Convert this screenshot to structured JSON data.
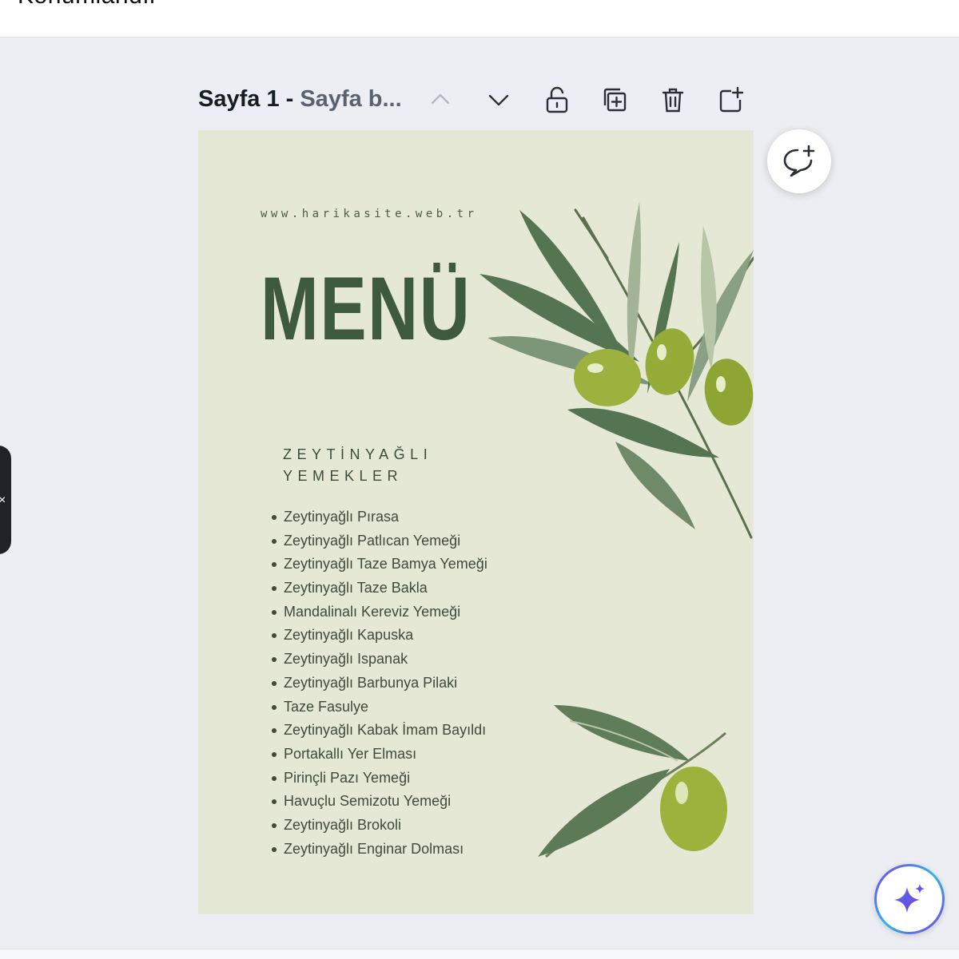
{
  "topbar": {
    "title": "Konumlandır"
  },
  "page_toolbar": {
    "page_number_label": "Sayfa 1 - ",
    "page_subtitle": "Sayfa b...",
    "buttons": {
      "move_up": "chevron-up-icon",
      "move_down": "chevron-down-icon",
      "lock": "unlock-icon",
      "duplicate": "duplicate-icon",
      "delete": "trash-icon",
      "add_page": "add-page-icon"
    }
  },
  "design": {
    "site_url": "www.harikasite.web.tr",
    "title": "MENÜ",
    "section_title": "ZEYTİNYAĞLI YEMEKLER",
    "dishes": [
      "Zeytinyağlı Pırasa",
      "Zeytinyağlı Patlıcan Yemeği",
      "Zeytinyağlı Taze Bamya Yemeği",
      "Zeytinyağlı Taze Bakla",
      "Mandalinalı Kereviz Yemeği",
      "Zeytinyağlı Kapuska",
      "Zeytinyağlı Ispanak",
      "Zeytinyağlı Barbunya Pilaki",
      "Taze Fasulye",
      "Zeytinyağlı Kabak İmam Bayıldı",
      "Portakallı Yer Elması",
      "Pirinçli Pazı Yemeği",
      "Havuçlu Semizotu Yemeği",
      "Zeytinyağlı Brokoli",
      "Zeytinyağlı Enginar Dolması"
    ],
    "colors": {
      "background": "#e4e8d4",
      "title": "#3e5a3e",
      "olive": "#8fa83a",
      "leaf": "#4f6f4a"
    }
  },
  "floating": {
    "comment": "add-comment-icon",
    "magic": "sparkle-icon",
    "side_panel_close": "×"
  }
}
